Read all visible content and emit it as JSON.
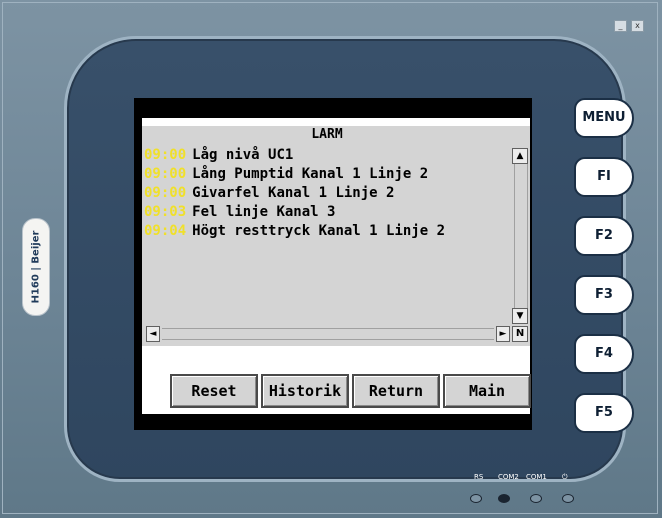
{
  "window": {
    "minimize_label": "_",
    "close_label": "x"
  },
  "device": {
    "brand_label": "H160 | Beijer"
  },
  "screen": {
    "title": "LARM",
    "alarms": [
      {
        "time": "09:00",
        "text": "Låg nivå UC1"
      },
      {
        "time": "09:00",
        "text": "Lång Pumptid Kanal 1 Linje 2"
      },
      {
        "time": "09:00",
        "text": "Givarfel Kanal 1 Linje 2"
      },
      {
        "time": "09:03",
        "text": "Fel linje Kanal 3"
      },
      {
        "time": "09:04",
        "text": "Högt resttryck Kanal 1 Linje 2"
      }
    ],
    "scroll_up": "▲",
    "scroll_down": "▼",
    "scroll_left": "◄",
    "scroll_right": "►",
    "n_button": "N",
    "buttons": {
      "reset": "Reset",
      "history": "Historik",
      "return": "Return",
      "main": "Main"
    }
  },
  "function_keys": {
    "menu": "MENU",
    "f1": "FI",
    "f2": "F2",
    "f3": "F3",
    "f4": "F4",
    "f5": "F5"
  },
  "status": {
    "labels": [
      "RS",
      "COM2",
      "COM1",
      "⏻"
    ],
    "com2_active": true
  },
  "colors": {
    "alarm_time": "#f0e02a",
    "bezel": "#2f465f",
    "screen_bg": "#d4d4d4"
  }
}
